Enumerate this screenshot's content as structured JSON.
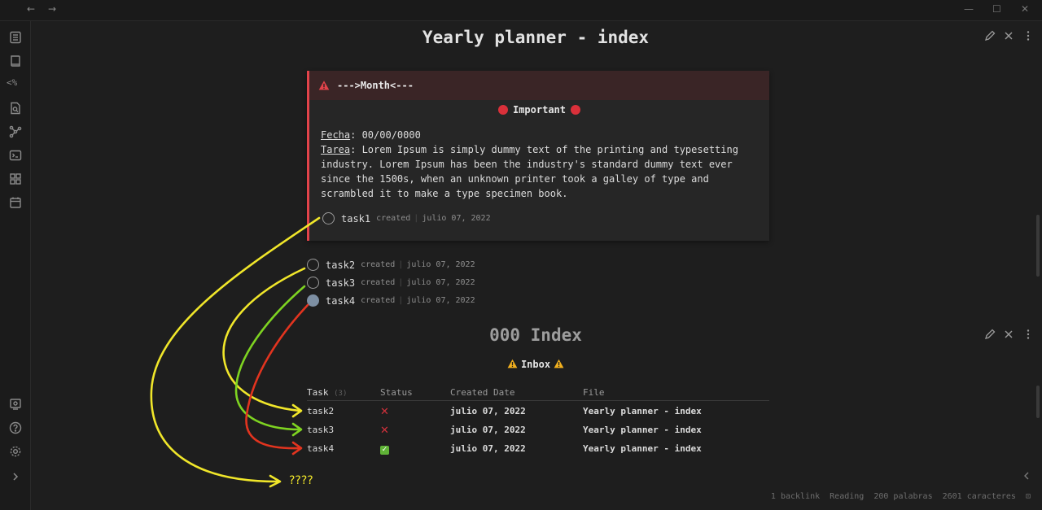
{
  "titlebar": {
    "back_icon": "arrow-left-icon",
    "forward_icon": "arrow-right-icon",
    "controls": [
      "minimize-icon",
      "maximize-icon",
      "close-icon"
    ]
  },
  "ribbon": {
    "top_icons": [
      "file-list-icon",
      "book-icon",
      "templater-icon",
      "file-search-icon",
      "graph-icon",
      "terminal-icon",
      "grid-icon",
      "calendar-icon"
    ],
    "templater_text": "<%",
    "bottom_icons": [
      "vault-icon",
      "help-icon",
      "settings-icon",
      "expand-icon"
    ]
  },
  "doc": {
    "title": "Yearly planner - index",
    "callout": {
      "heading": "--->Month<---",
      "important": "Important",
      "fecha_label": "Fecha",
      "fecha_value": ": 00/00/0000",
      "tarea_label": "Tarea",
      "tarea_value": ": Lorem Ipsum is simply dummy text of the printing and typesetting industry. Lorem Ipsum has been the industry's standard dummy text ever since the 1500s, when an unknown printer took a galley of type and scrambled it to make a type specimen book.",
      "task1": {
        "name": "task1",
        "meta_label": "created",
        "date": "julio 07, 2022",
        "done": false
      }
    },
    "tasks": [
      {
        "name": "task2",
        "meta_label": "created",
        "date": "julio 07, 2022",
        "done": false
      },
      {
        "name": "task3",
        "meta_label": "created",
        "date": "julio 07, 2022",
        "done": false
      },
      {
        "name": "task4",
        "meta_label": "created",
        "date": "julio 07, 2022",
        "done": true
      }
    ]
  },
  "index": {
    "title": "000 Index",
    "inbox": "Inbox",
    "table": {
      "headers": {
        "task": "Task",
        "count": "(3)",
        "status": "Status",
        "created": "Created Date",
        "file": "File"
      },
      "rows": [
        {
          "task": "task2",
          "status": "✕",
          "date": "julio 07, 2022",
          "file": "Yearly planner - index",
          "done": false
        },
        {
          "task": "task3",
          "status": "✕",
          "date": "julio 07, 2022",
          "file": "Yearly planner - index",
          "done": false
        },
        {
          "task": "task4",
          "status": "✓",
          "date": "julio 07, 2022",
          "file": "Yearly planner - index",
          "done": true
        }
      ]
    }
  },
  "annotation": {
    "question": "????",
    "colors": {
      "yellow": "#f0e62a",
      "green": "#7ed321",
      "red": "#e2341f"
    }
  },
  "statusbar": {
    "backlinks": "1 backlink",
    "mode": "Reading",
    "words": "200 palabras",
    "chars": "2601 caracteres"
  },
  "colors": {
    "accent_red": "#e2434a",
    "bg": "#1e1e1e",
    "ribbon_bg": "#1b1b1b"
  }
}
